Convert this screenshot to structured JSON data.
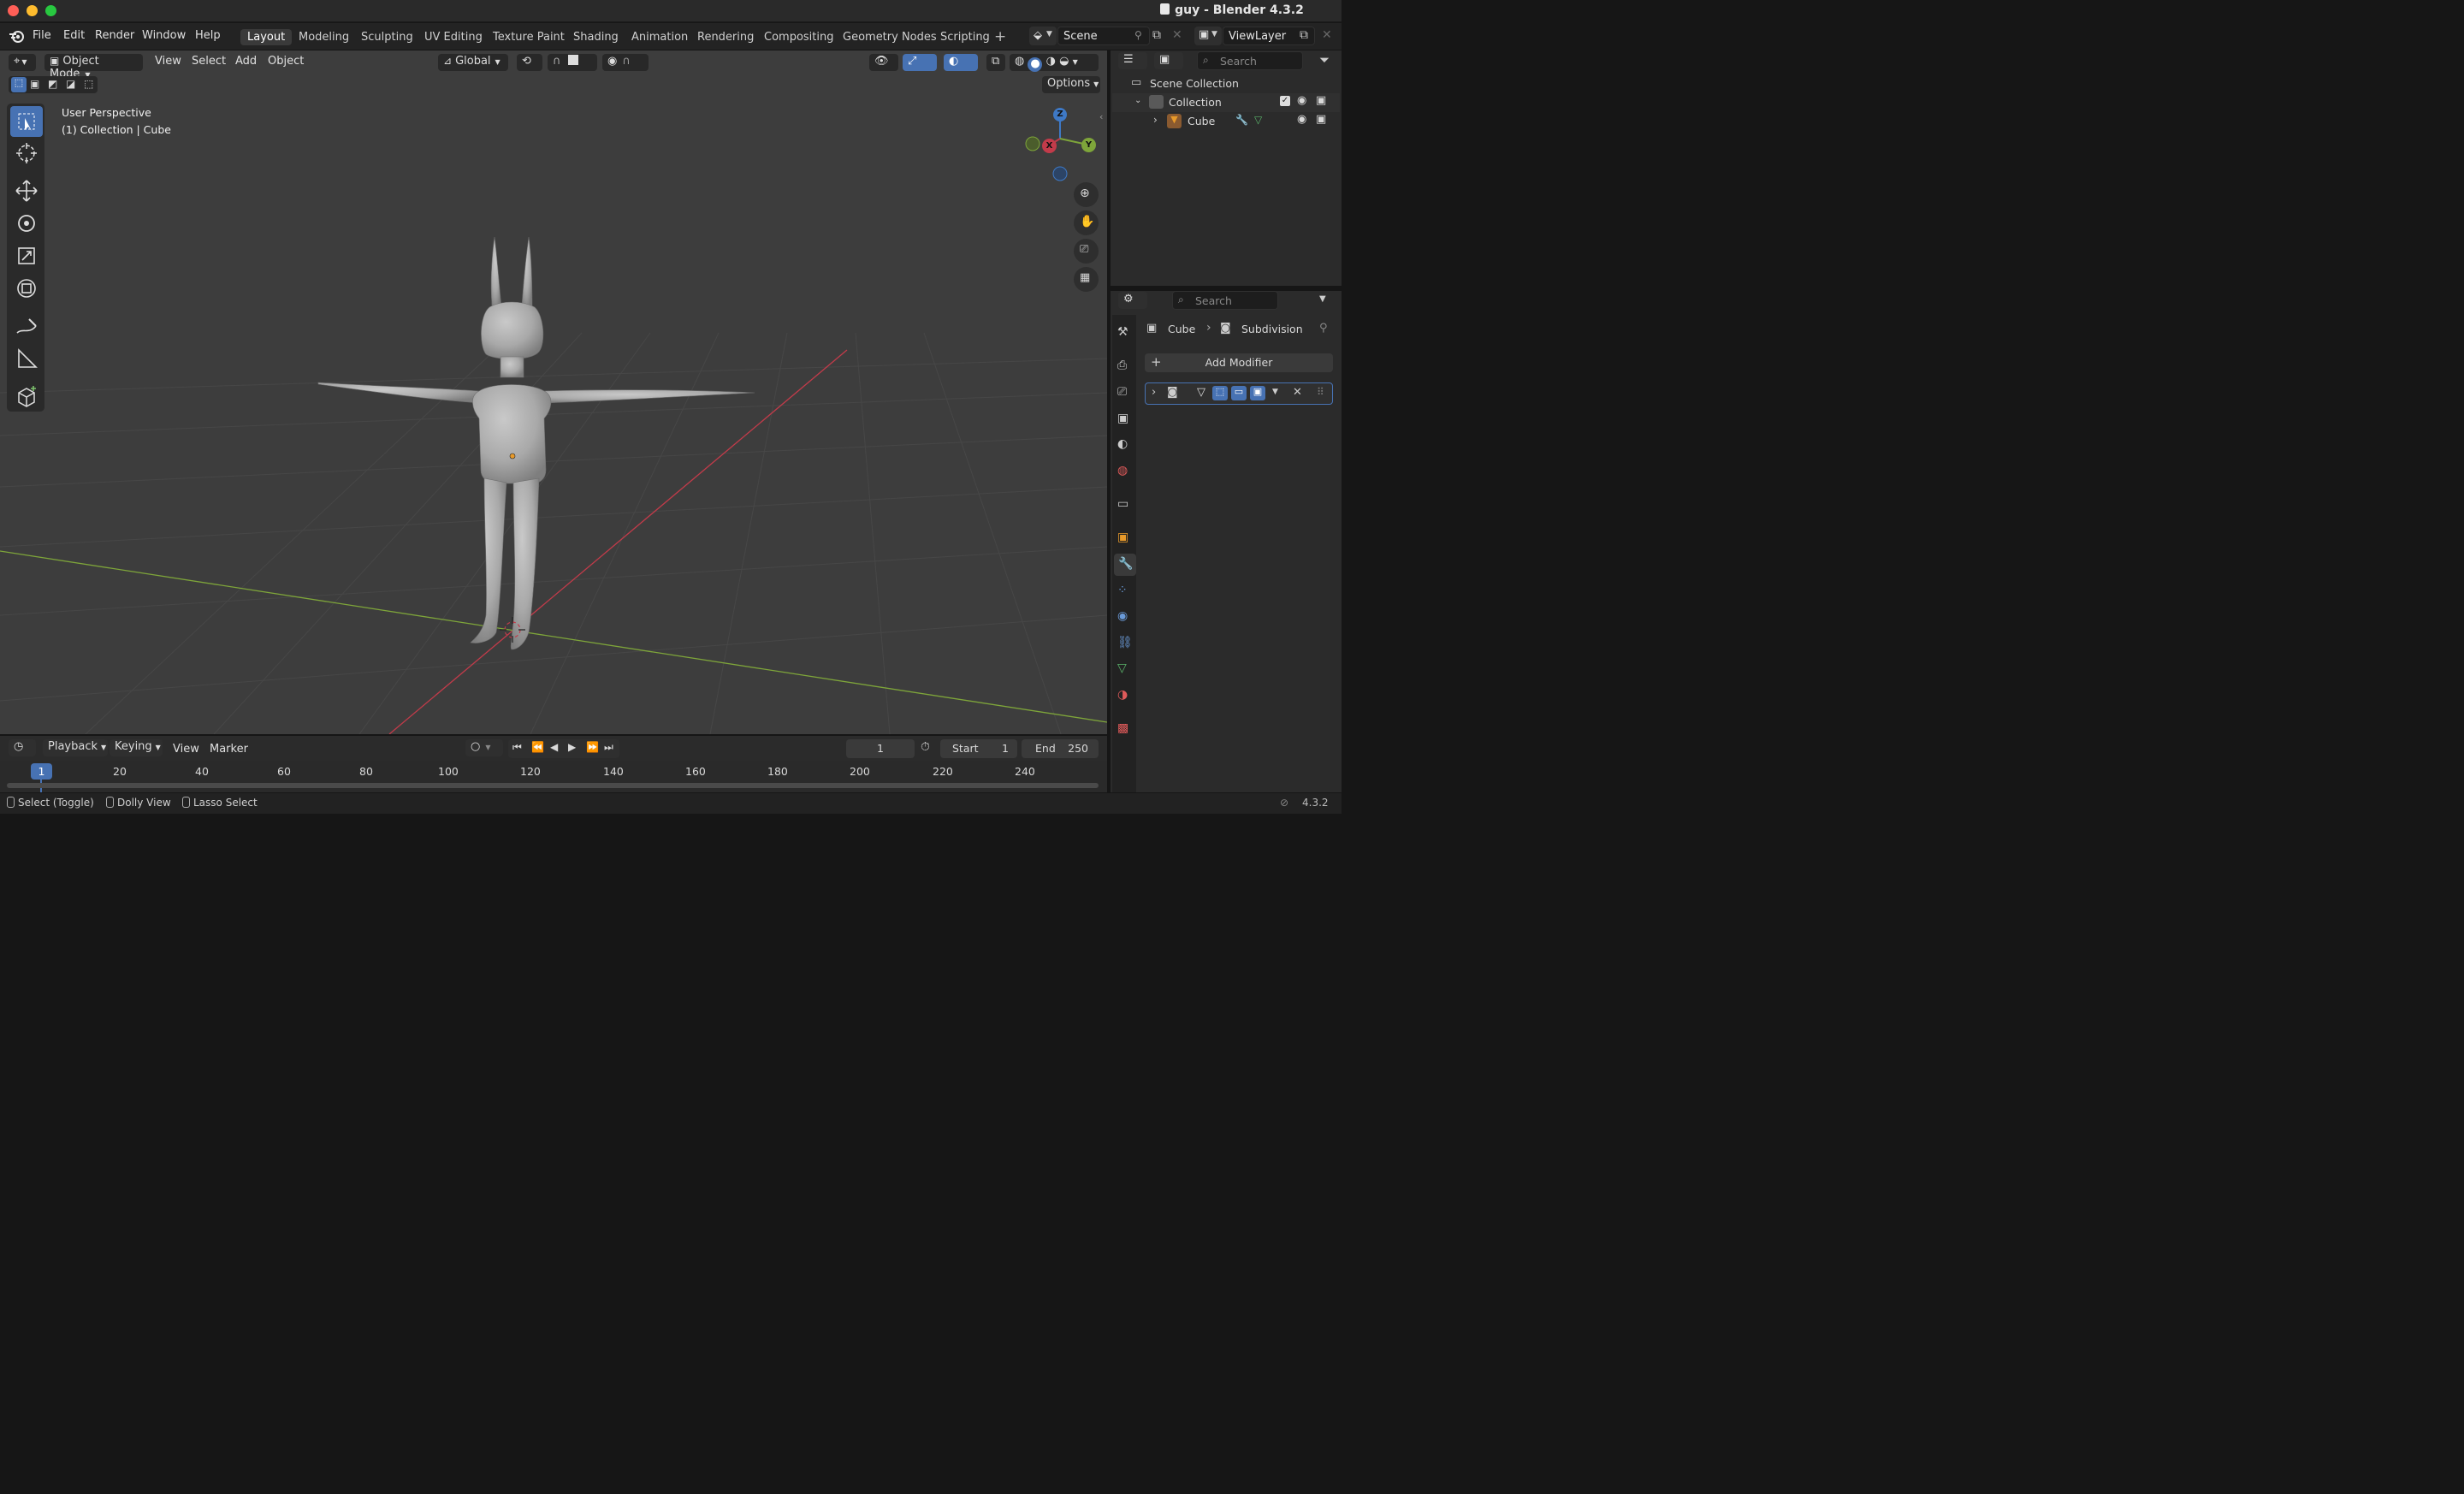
{
  "window": {
    "title": "guy - Blender 4.3.2"
  },
  "menus": [
    "File",
    "Edit",
    "Render",
    "Window",
    "Help"
  ],
  "workspaces": [
    "Layout",
    "Modeling",
    "Sculpting",
    "UV Editing",
    "Texture Paint",
    "Shading",
    "Animation",
    "Rendering",
    "Compositing",
    "Geometry Nodes",
    "Scripting"
  ],
  "scene": {
    "name": "Scene",
    "view_layer": "ViewLayer"
  },
  "viewport_header": {
    "mode": "Object Mode",
    "menus": [
      "View",
      "Select",
      "Add",
      "Object"
    ],
    "orientation": "Global",
    "options_label": "Options"
  },
  "viewport": {
    "perspective": "User Perspective",
    "context": "(1) Collection | Cube"
  },
  "gizmo": {
    "x": "X",
    "y": "Y",
    "z": "Z"
  },
  "outliner": {
    "search_placeholder": "Search",
    "scene_collection": "Scene Collection",
    "collection": "Collection",
    "object": "Cube"
  },
  "properties": {
    "search_placeholder": "Search",
    "breadcrumb_object": "Cube",
    "breadcrumb_modifier": "Subdivision",
    "add_modifier": "Add Modifier"
  },
  "timeline": {
    "menus": [
      "Playback",
      "Keying",
      "View",
      "Marker"
    ],
    "current_frame": "1",
    "start_label": "Start",
    "start_value": "1",
    "end_label": "End",
    "end_value": "250",
    "ruler_current": "1",
    "ruler_ticks": [
      "20",
      "40",
      "60",
      "80",
      "100",
      "120",
      "140",
      "160",
      "180",
      "200",
      "220",
      "240"
    ]
  },
  "statusbar": {
    "hints": [
      "Select (Toggle)",
      "Dolly View",
      "Lasso Select"
    ],
    "version": "4.3.2"
  },
  "colors": {
    "accent": "#4772b3",
    "x_axis": "#c23b4a",
    "y_axis": "#7ea53a",
    "z_axis": "#3e79c6"
  }
}
